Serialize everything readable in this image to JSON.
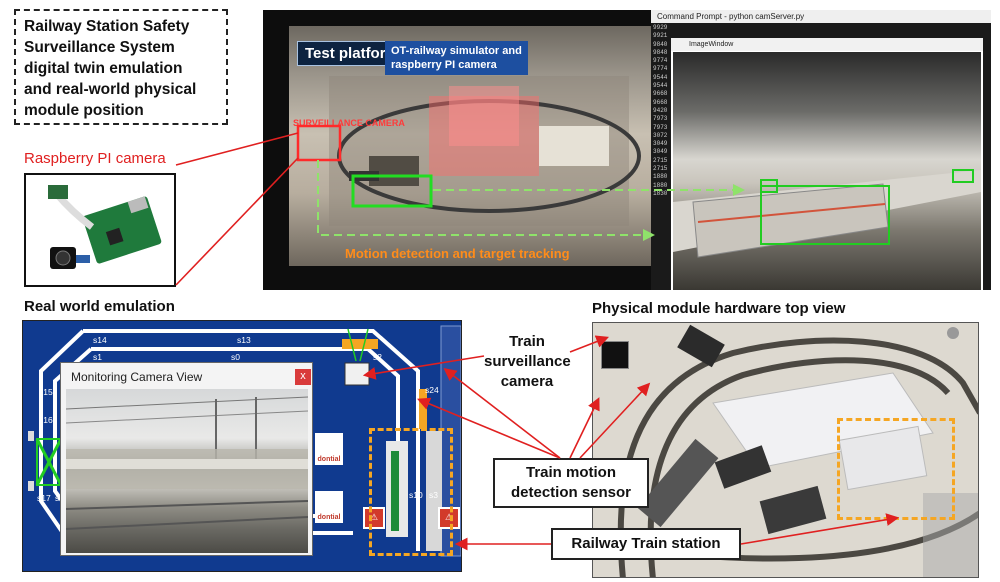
{
  "title_lines": [
    "Railway Station Safety",
    "Surveillance System",
    "digital twin emulation",
    "and real-world physical",
    "module position"
  ],
  "raspberry_label": "Raspberry PI camera",
  "platform": {
    "tag": "Test platform",
    "desc_line1": "OT-railway simulator and",
    "desc_line2": "raspberry PI camera",
    "surveillance_tag": "SURVEILLANCE CAMERA",
    "motion_text": "Motion detection and target tracking",
    "cmd_title": "Command Prompt - python camServer.py",
    "image_window_title": "ImageWindow",
    "cmd_numbers": [
      "9929",
      "9921",
      "9840",
      "9848",
      "9774",
      "9774",
      "9544",
      "9544",
      "9668",
      "9668",
      "9420",
      "7973",
      "7973",
      "3072",
      "3049",
      "3049",
      "2715",
      "2715",
      "1880",
      "1880",
      "1830"
    ]
  },
  "real_world_title": "Real world emulation",
  "physical_title": "Physical module hardware top view",
  "emulation": {
    "track_labels": [
      "s14",
      "s13",
      "s1",
      "s0",
      "s2",
      "s15",
      "s16",
      "s24",
      "s17",
      "s4",
      "s10",
      "s3"
    ],
    "monitor_title": "Monitoring Camera View",
    "monitor_close": "x",
    "building_text": "dontial"
  },
  "callouts": {
    "camera": [
      "Train",
      "surveillance",
      "camera"
    ],
    "sensor": [
      "Train motion",
      "detection sensor"
    ],
    "station": "Railway Train station"
  },
  "colors": {
    "red": "#e02020",
    "green": "#22cc22",
    "orange": "#f5a623",
    "emu_blue": "#103a8f"
  }
}
